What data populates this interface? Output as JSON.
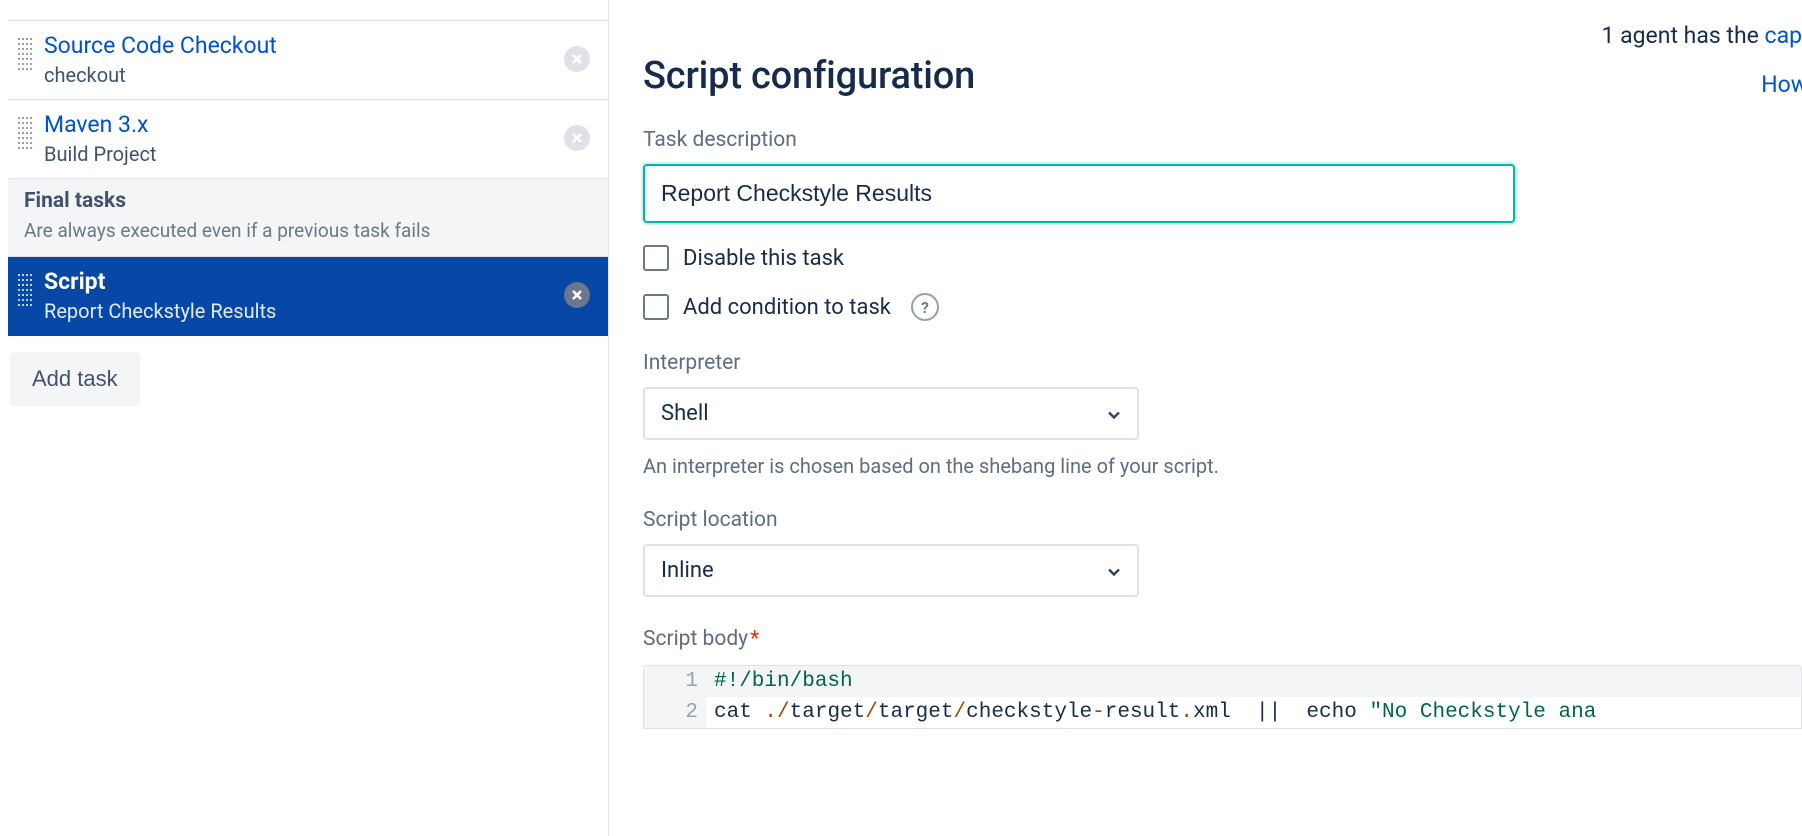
{
  "top_note_prefix": "1 agent has the ",
  "top_note_link": "cap",
  "sidebar": {
    "tasks": [
      {
        "title": "Source Code Checkout",
        "sub": "checkout"
      },
      {
        "title": "Maven 3.x",
        "sub": "Build Project"
      }
    ],
    "final": {
      "title": "Final tasks",
      "sub": "Are always executed even if a previous task fails"
    },
    "selected": {
      "title": "Script",
      "sub": "Report Checkstyle Results"
    },
    "add_task": "Add task"
  },
  "main": {
    "heading": "Script configuration",
    "how_link": "How",
    "labels": {
      "task_description": "Task description",
      "interpreter": "Interpreter",
      "script_location": "Script location",
      "script_body": "Script body"
    },
    "task_description_value": "Report Checkstyle Results",
    "disable_label": "Disable this task",
    "add_condition_label": "Add condition to task",
    "interpreter_value": "Shell",
    "interpreter_hint": "An interpreter is chosen based on the shebang line of your script.",
    "script_location_value": "Inline",
    "script": {
      "line1": "#!/bin/bash",
      "line2_cmd": "cat ",
      "line2_dot": ".",
      "line2_s1": "/",
      "line2_p1": "target",
      "line2_s2": "/",
      "line2_p2": "target",
      "line2_s3": "/",
      "line2_p3": "checkstyle",
      "line2_dash": "-",
      "line2_p4": "result",
      "line2_dot2": ".",
      "line2_p5": "xml ",
      "line2_pipe": " || ",
      "line2_echo_pre": " echo ",
      "line2_str": "\"No Checkstyle ana"
    }
  }
}
